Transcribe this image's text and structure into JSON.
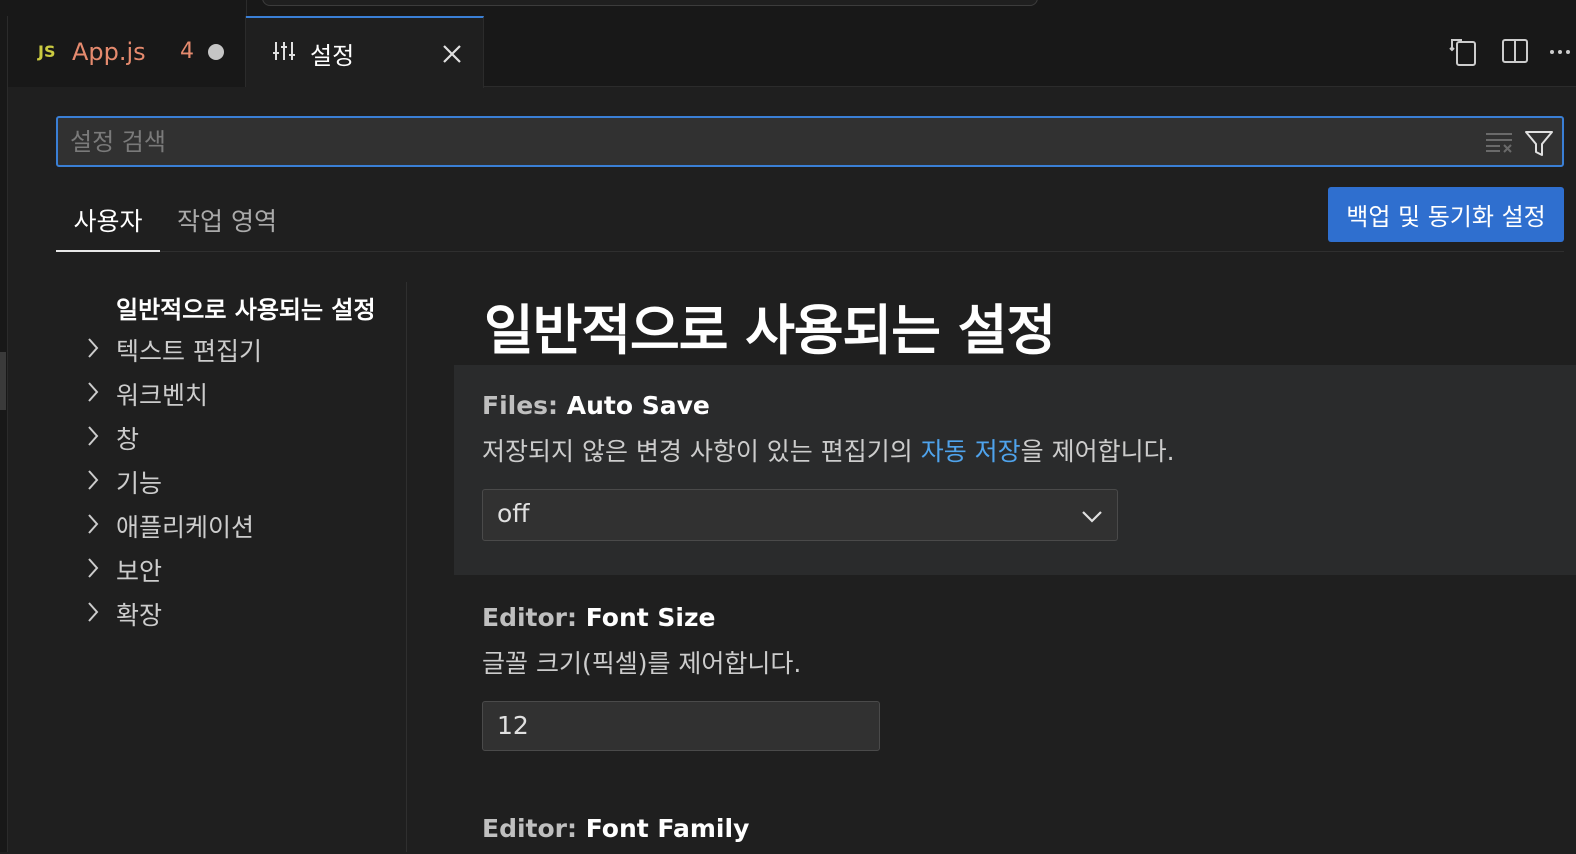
{
  "tabs": {
    "app": {
      "icon_text": "JS",
      "label": "App.js",
      "problem_count": "4"
    },
    "settings": {
      "label": "설정"
    }
  },
  "search": {
    "placeholder": "설정 검색"
  },
  "scope_tabs": {
    "user": "사용자",
    "workspace": "작업 영역"
  },
  "sync_button": {
    "label": "백업 및 동기화 설정"
  },
  "toc": {
    "items": [
      {
        "label": "일반적으로 사용되는 설정"
      },
      {
        "label": "텍스트 편집기"
      },
      {
        "label": "워크벤치"
      },
      {
        "label": "창"
      },
      {
        "label": "기능"
      },
      {
        "label": "애플리케이션"
      },
      {
        "label": "보안"
      },
      {
        "label": "확장"
      }
    ]
  },
  "main": {
    "section_title": "일반적으로 사용되는 설정",
    "settings": [
      {
        "category": "Files: ",
        "name": "Auto Save",
        "desc_prefix": "저장되지 않은 변경 사항이 있는 편집기의 ",
        "desc_link": "자동 저장",
        "desc_suffix": "을 제어합니다.",
        "value": "off"
      },
      {
        "category": "Editor: ",
        "name": "Font Size",
        "desc": "글꼴 크기(픽셀)를 제어합니다.",
        "value": "12"
      },
      {
        "category": "Editor: ",
        "name": "Font Family"
      }
    ]
  },
  "colors": {
    "accent": "#3a7fd5",
    "button": "#2f6fcf",
    "link": "#4fa3ec",
    "modified": "#e58a6e",
    "js_icon": "#cbcb41"
  }
}
